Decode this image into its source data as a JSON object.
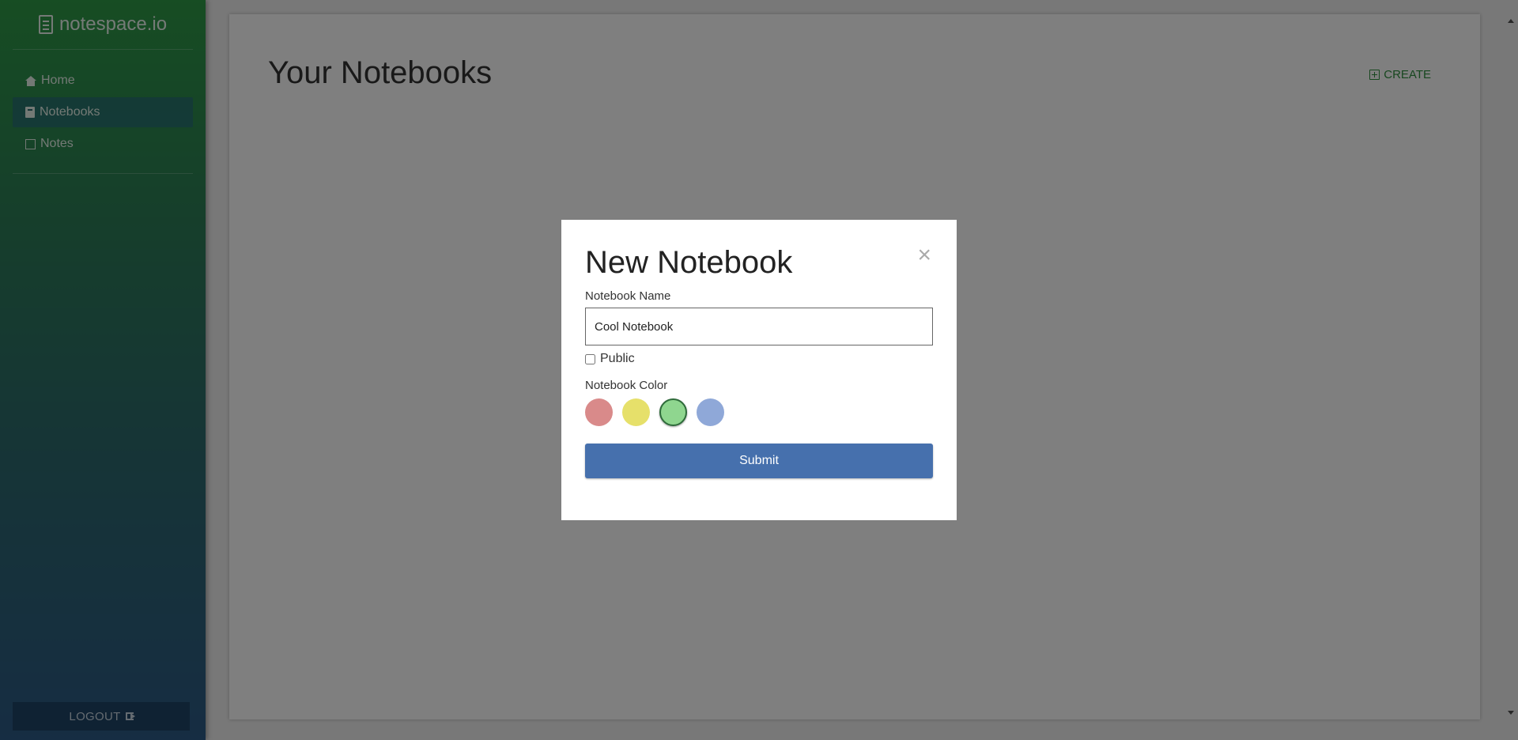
{
  "sidebar": {
    "brand": "notespace.io",
    "items": [
      {
        "label": "Home",
        "icon": "home-icon"
      },
      {
        "label": "Notebooks",
        "icon": "book-icon",
        "active": true
      },
      {
        "label": "Notes",
        "icon": "note-icon"
      }
    ],
    "logout_label": "LOGOUT"
  },
  "main": {
    "title": "Your Notebooks",
    "create_label": "CREATE"
  },
  "modal": {
    "title": "New Notebook",
    "close_symbol": "×",
    "name_label": "Notebook Name",
    "name_value": "Cool Notebook",
    "public_label": "Public",
    "public_checked": false,
    "color_label": "Notebook Color",
    "colors": [
      {
        "name": "red",
        "hex": "#d98a8a",
        "selected": false
      },
      {
        "name": "yellow",
        "hex": "#e6e06a",
        "selected": false
      },
      {
        "name": "green",
        "hex": "#8fd68f",
        "selected": true
      },
      {
        "name": "blue",
        "hex": "#8fa8d8",
        "selected": false
      }
    ],
    "submit_label": "Submit"
  },
  "colors": {
    "accent_green": "#2f8f3f",
    "submit_blue": "#4670ad",
    "logout_bg": "#1f4566"
  }
}
